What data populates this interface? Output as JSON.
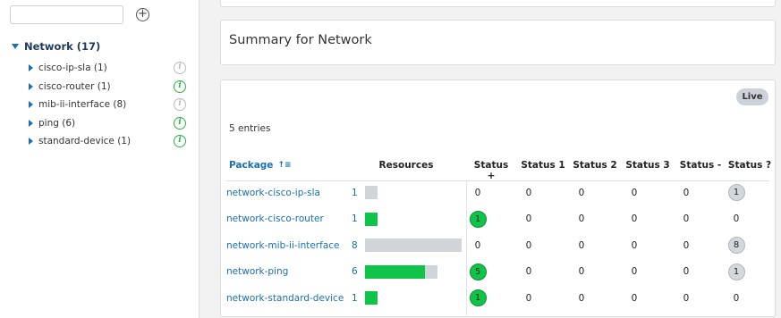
{
  "sidebar": {
    "search": {
      "value": "",
      "placeholder": ""
    },
    "add_label": "+",
    "root": {
      "label": "Network (17)"
    },
    "items": [
      {
        "label": "cisco-ip-sla (1)",
        "info": "i",
        "status": "gray"
      },
      {
        "label": "cisco-router (1)",
        "info": "i",
        "status": "green"
      },
      {
        "label": "mib-ii-interface (8)",
        "info": "i",
        "status": "gray"
      },
      {
        "label": "ping (6)",
        "info": "i",
        "status": "green"
      },
      {
        "label": "standard-device (1)",
        "info": "i",
        "status": "green"
      }
    ]
  },
  "summary": {
    "title": "Summary for Network"
  },
  "table": {
    "live_label": "Live",
    "entries_text": "5 entries",
    "sort_icon": "↑≡",
    "headers": {
      "package": "Package",
      "resources": "Resources",
      "status_plus": "Status +",
      "status_1": "Status 1",
      "status_2": "Status 2",
      "status_3": "Status 3",
      "status_minus": "Status -",
      "status_q": "Status ?"
    },
    "rows": [
      {
        "package": "network-cisco-ip-sla",
        "count": "1",
        "ok_fraction": 0.0,
        "status_plus": "0",
        "status_1": "0",
        "status_2": "0",
        "status_3": "0",
        "status_minus": "0",
        "status_q": "1"
      },
      {
        "package": "network-cisco-router",
        "count": "1",
        "ok_fraction": 1.0,
        "status_plus": "1",
        "status_1": "0",
        "status_2": "0",
        "status_3": "0",
        "status_minus": "0",
        "status_q": "0"
      },
      {
        "package": "network-mib-ii-interface",
        "count": "8",
        "ok_fraction": 0.0,
        "status_plus": "0",
        "status_1": "0",
        "status_2": "0",
        "status_3": "0",
        "status_minus": "0",
        "status_q": "8"
      },
      {
        "package": "network-ping",
        "count": "6",
        "ok_fraction": 0.8333,
        "status_plus": "5",
        "status_1": "0",
        "status_2": "0",
        "status_3": "0",
        "status_minus": "0",
        "status_q": "1"
      },
      {
        "package": "network-standard-device",
        "count": "1",
        "ok_fraction": 1.0,
        "status_plus": "1",
        "status_1": "0",
        "status_2": "0",
        "status_3": "0",
        "status_minus": "0",
        "status_q": "0"
      }
    ]
  },
  "colors": {
    "ok": "#10c44a",
    "unknown": "#d3d8dd",
    "link": "#1a6fb0"
  }
}
